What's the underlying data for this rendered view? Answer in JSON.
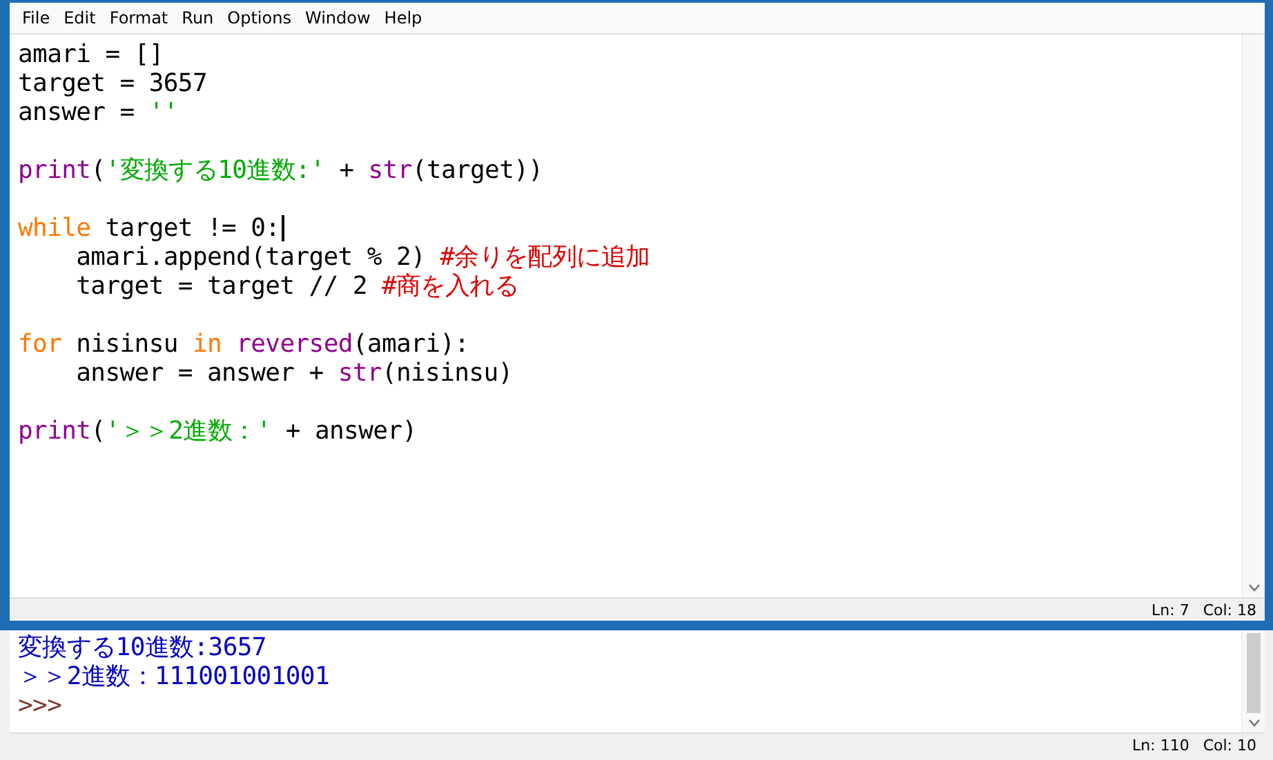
{
  "editor": {
    "menu": [
      "File",
      "Edit",
      "Format",
      "Run",
      "Options",
      "Window",
      "Help"
    ],
    "blocks": [
      [
        {
          "caret": false,
          "tokens": [
            {
              "kind": "plain",
              "text": "amari = []"
            }
          ]
        },
        {
          "caret": false,
          "tokens": [
            {
              "kind": "plain",
              "text": "target = 3657"
            }
          ]
        },
        {
          "caret": false,
          "tokens": [
            {
              "kind": "plain",
              "text": "answer = "
            },
            {
              "kind": "string",
              "text": "''"
            }
          ]
        }
      ],
      [
        {
          "caret": false,
          "tokens": [
            {
              "kind": "builtin",
              "text": "print"
            },
            {
              "kind": "plain",
              "text": "("
            },
            {
              "kind": "string",
              "text": "'変換する10進数:'"
            },
            {
              "kind": "plain",
              "text": " + "
            },
            {
              "kind": "builtin",
              "text": "str"
            },
            {
              "kind": "plain",
              "text": "(target))"
            }
          ]
        }
      ],
      [
        {
          "caret": true,
          "tokens": [
            {
              "kind": "keyword",
              "text": "while"
            },
            {
              "kind": "plain",
              "text": " target != 0:"
            }
          ]
        },
        {
          "caret": false,
          "tokens": [
            {
              "kind": "plain",
              "text": "    amari.append(target % 2) "
            },
            {
              "kind": "comment",
              "text": "#余りを配列に追加"
            }
          ]
        },
        {
          "caret": false,
          "tokens": [
            {
              "kind": "plain",
              "text": "    target = target // 2 "
            },
            {
              "kind": "comment",
              "text": "#商を入れる"
            }
          ]
        }
      ],
      [
        {
          "caret": false,
          "tokens": [
            {
              "kind": "keyword",
              "text": "for"
            },
            {
              "kind": "plain",
              "text": " nisinsu "
            },
            {
              "kind": "keyword",
              "text": "in "
            },
            {
              "kind": "builtin",
              "text": "reversed"
            },
            {
              "kind": "plain",
              "text": "(amari):"
            }
          ]
        },
        {
          "caret": false,
          "tokens": [
            {
              "kind": "plain",
              "text": "    answer = answer + "
            },
            {
              "kind": "builtin",
              "text": "str"
            },
            {
              "kind": "plain",
              "text": "(nisinsu)"
            }
          ]
        }
      ],
      [
        {
          "caret": false,
          "tokens": [
            {
              "kind": "builtin",
              "text": "print"
            },
            {
              "kind": "plain",
              "text": "("
            },
            {
              "kind": "string",
              "text": "'＞＞2進数：'"
            },
            {
              "kind": "plain",
              "text": " + answer)"
            }
          ]
        }
      ]
    ],
    "status": [
      "Ln: 7",
      "Col: 18"
    ]
  },
  "shell": {
    "lines": [
      {
        "kind": "output",
        "text": "変換する10進数:3657"
      },
      {
        "kind": "output",
        "text": "＞＞2進数：111001001001"
      },
      {
        "kind": "prompt",
        "text": ">>>"
      }
    ],
    "status": [
      "Ln: 110",
      "Col: 10"
    ]
  }
}
